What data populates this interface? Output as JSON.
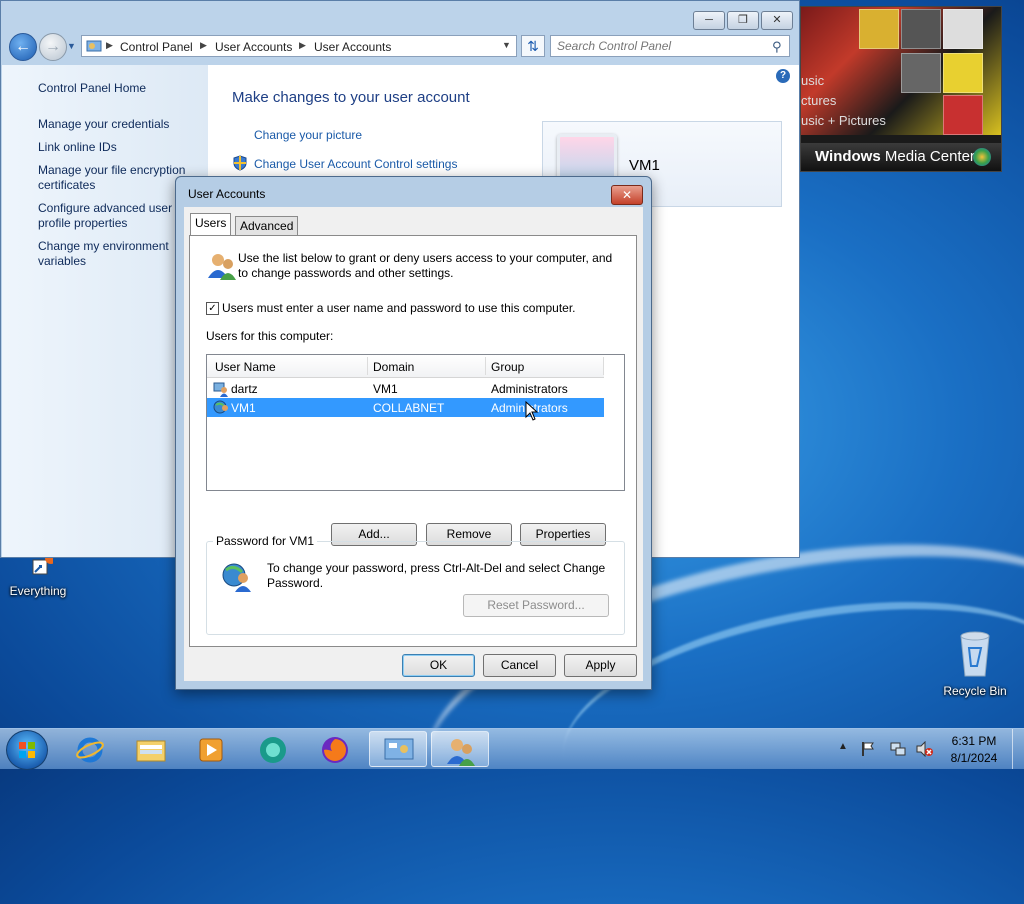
{
  "control_panel": {
    "address": {
      "crumb_1": "Control Panel",
      "crumb_2": "User Accounts",
      "crumb_3": "User Accounts",
      "search_placeholder": "Search Control Panel"
    },
    "sidebar": {
      "home": "Control Panel Home",
      "items": [
        "Manage your credentials",
        "Link online IDs",
        "Manage your file encryption certificates",
        "Configure advanced user profile properties",
        "Change my environment variables"
      ]
    },
    "main": {
      "heading": "Make changes to your user account",
      "links": [
        "Change your picture",
        "Change User Account Control settings"
      ],
      "user_name": "VM1"
    }
  },
  "dialog": {
    "title": "User Accounts",
    "close_label": "x",
    "tabs": [
      "Users",
      "Advanced"
    ],
    "intro": "Use the list below to grant or deny users access to your computer, and to change passwords and other settings.",
    "checkbox_label": "Users must enter a user name and password to use this computer.",
    "checkbox_checked": true,
    "list_label": "Users for this computer:",
    "columns": [
      "User Name",
      "Domain",
      "Group"
    ],
    "rows": [
      {
        "user": "dartz",
        "domain": "VM1",
        "group": "Administrators",
        "selected": false
      },
      {
        "user": "VM1",
        "domain": "COLLABNET",
        "group": "Administrators",
        "selected": true
      }
    ],
    "buttons": {
      "add": "Add...",
      "remove": "Remove",
      "properties": "Properties"
    },
    "password_group": {
      "label": "Password for VM1",
      "text": "To change your password, press Ctrl-Alt-Del and select Change Password.",
      "reset": "Reset Password..."
    },
    "footer": {
      "ok": "OK",
      "cancel": "Cancel",
      "apply": "Apply"
    }
  },
  "media_center": {
    "menu": [
      "usic",
      "ctures",
      "usic + Pictures"
    ],
    "title_bold": "Windows",
    "title_rest": " Media Center"
  },
  "desktop": {
    "icons": [
      "Everything",
      "Recycle Bin"
    ]
  },
  "taskbar": {
    "time": "6:31 PM",
    "date": "8/1/2024",
    "show_hidden": "▲"
  },
  "colors": {
    "link": "#1a5aa8",
    "heading": "#1e3f85",
    "selection": "#3399ff"
  }
}
